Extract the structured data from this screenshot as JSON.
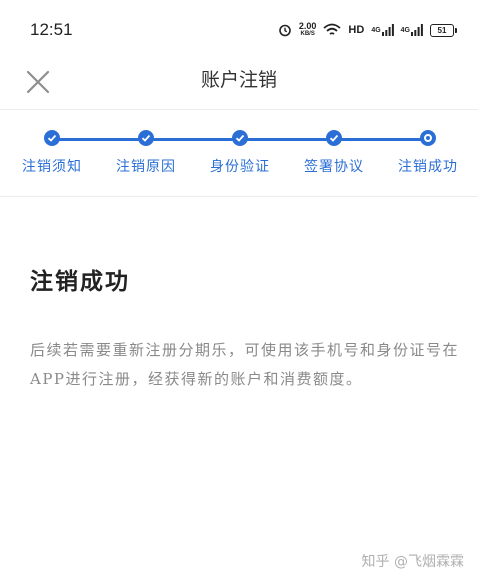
{
  "status_bar": {
    "time": "12:51",
    "net_speed_value": "2.00",
    "net_speed_unit": "KB/S",
    "hd_label": "HD",
    "signal1_label": "4G",
    "signal2_label": "4G",
    "battery_level": "51"
  },
  "nav": {
    "title": "账户注销",
    "close_icon": "close-icon"
  },
  "steps": [
    {
      "label": "注销须知",
      "state": "done"
    },
    {
      "label": "注销原因",
      "state": "done"
    },
    {
      "label": "身份验证",
      "state": "done"
    },
    {
      "label": "签署协议",
      "state": "done"
    },
    {
      "label": "注销成功",
      "state": "current"
    }
  ],
  "result": {
    "title": "注销成功",
    "description": "后续若需要重新注册分期乐，可使用该手机号和身份证号在APP进行注册，经获得新的账户和消费额度。"
  },
  "watermark": "知乎 @飞烟霖霖",
  "colors": {
    "accent": "#2b6fd6",
    "text_primary": "#222222",
    "text_secondary": "#8a8a8a"
  }
}
